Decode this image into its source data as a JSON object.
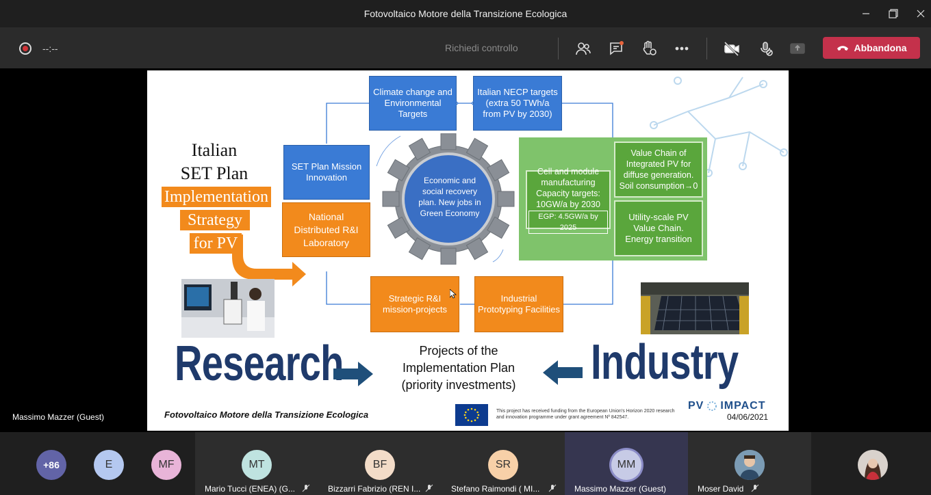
{
  "window": {
    "title": "Fotovoltaico Motore della Transizione Ecologica"
  },
  "toolbar": {
    "timer": "--:--",
    "request_control": "Richiedi controllo",
    "leave_label": "Abbandona"
  },
  "presenter": {
    "label": "Massimo Mazzer (Guest)"
  },
  "slide": {
    "top_left_box": "Climate change and Environmental Targets",
    "top_right_box": "Italian NECP targets (extra 50 TWh/a from PV by 2030)",
    "set_title_1": "Italian",
    "set_title_2": "SET Plan",
    "impl_1": "Implementation",
    "impl_2": "Strategy",
    "impl_3": "for PV",
    "set_mission": "SET Plan Mission Innovation",
    "national_lab": "National Distributed R&I Laboratory",
    "gear_text": "Economic and social recovery plan. New jobs in Green Economy",
    "cell_module": "Cell and module manufacturing Capacity targets: 10GW/a by 2030",
    "egp": "EGP: 4.5GW/a by 2025",
    "value_chain": "Value Chain of Integrated PV for diffuse generation. Soil consumption→0",
    "utility_scale": "Utility-scale PV Value Chain. Energy transition",
    "strategic": "Strategic R&I mission-projects",
    "industrial": "Industrial Prototyping Facilities",
    "research": "Research",
    "industry": "Industry",
    "center_1": "Projects of the",
    "center_2": "Implementation Plan",
    "center_3": "(priority investments)",
    "footer_title": "Fotovoltaico Motore della Transizione Ecologica",
    "eu_text": "This project has received funding from the European Union's Horizon 2020 research and innovation programme under grant agreement Nº 842547.",
    "brand_left": "PV",
    "brand_right": "IMPACT",
    "date": "04/06/2021"
  },
  "participants": {
    "overflow": "+86",
    "small": [
      {
        "initials": "E",
        "color": "#b4c8f0"
      },
      {
        "initials": "MF",
        "color": "#e8b4d8"
      }
    ],
    "tiles": [
      {
        "initials": "MT",
        "name": "Mario Tucci (ENEA) (G...",
        "color": "#bfe3e0"
      },
      {
        "initials": "BF",
        "name": "Bizzarri Fabrizio (REN I...",
        "color": "#f3dcc8"
      },
      {
        "initials": "SR",
        "name": "Stefano Raimondi ( MI...",
        "color": "#f7d0a8"
      },
      {
        "initials": "MM",
        "name": "Massimo Mazzer (Guest)",
        "color": "#c7cbe6"
      },
      {
        "initials": "",
        "name": "Moser David",
        "color": "#6f8fa8"
      }
    ]
  }
}
